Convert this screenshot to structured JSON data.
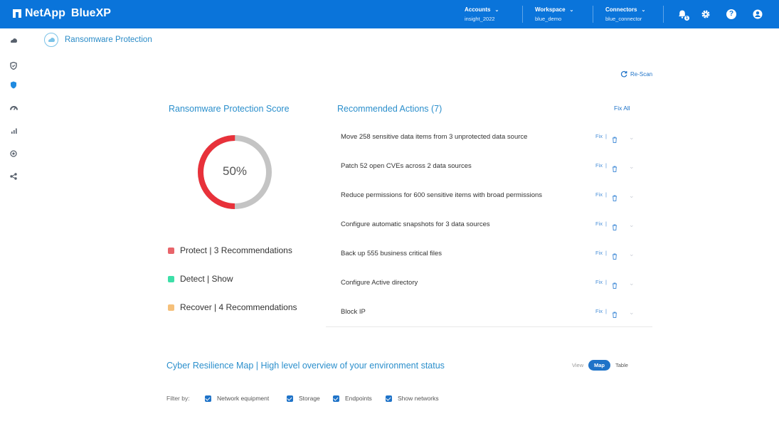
{
  "topbar": {
    "brand": "NetApp",
    "product": "BlueXP",
    "accounts": {
      "label": "Accounts",
      "value": "insight_2022"
    },
    "workspace": {
      "label": "Workspace",
      "value": "blue_demo"
    },
    "connectors": {
      "label": "Connectors",
      "value": "blue_connector"
    },
    "notification_count": "1",
    "icons": [
      "bell-icon",
      "gear-icon",
      "help-icon",
      "user-icon"
    ],
    "background": "#0a74da"
  },
  "sidebar": {
    "icons": [
      "storage-icon",
      "shield-check-icon",
      "shield-icon",
      "gauge-icon",
      "bar-chart-icon",
      "target-icon",
      "share-icon"
    ]
  },
  "page": {
    "title": "Ransomware Protection",
    "rescan_label": "Re-Scan"
  },
  "score": {
    "title": "Ransomware Protection Score",
    "percent": 50,
    "display": "50%",
    "colors": {
      "filled": "#e8313a",
      "empty": "#c4c4c4"
    },
    "legend": [
      {
        "label": "Protect | 3 Recommendations",
        "color": "#e8646a"
      },
      {
        "label": "Detect | Show",
        "color": "#3ddfa8"
      },
      {
        "label": "Recover | 4 Recommendations",
        "color": "#f5c07a"
      }
    ]
  },
  "actions": {
    "title": "Recommended Actions (7)",
    "fix_all_label": "Fix All",
    "fix_label": "Fix",
    "separator": "|",
    "items": [
      "Move 258 sensitive data items from 3 unprotected data source",
      "Patch 52 open CVEs across 2 data sources",
      "Reduce permissions for 600 sensitive items with broad permissions",
      "Configure automatic snapshots for 3 data sources",
      "Back up 555 business critical files",
      "Configure Active directory",
      "Block IP"
    ]
  },
  "cyber_map": {
    "title": "Cyber Resilience Map | High level overview of your environment status",
    "view_label": "View",
    "view_options": [
      "Map",
      "Table"
    ],
    "selected_view": "Map",
    "filter_label": "Filter by:",
    "filters": [
      "Network equipment",
      "Storage",
      "Endpoints",
      "Show networks"
    ]
  }
}
